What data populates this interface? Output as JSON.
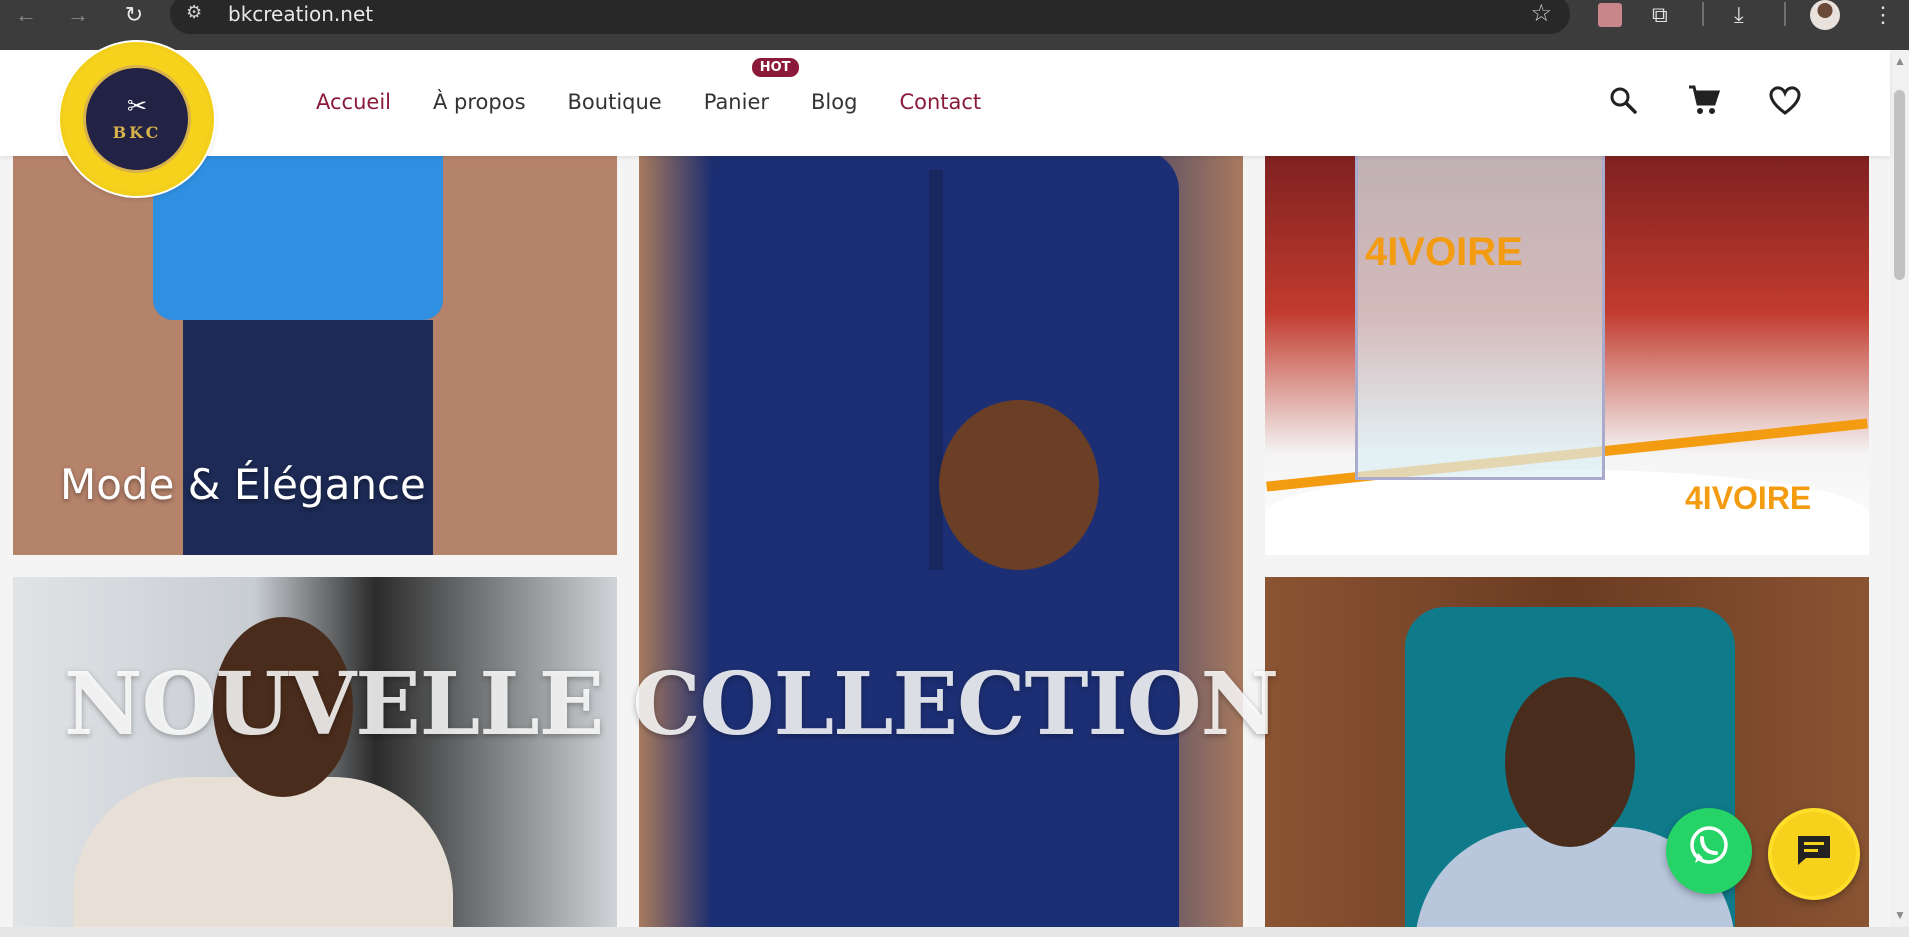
{
  "browser": {
    "url": "bkcreation.net",
    "back_icon": "arrow-left",
    "forward_icon": "arrow-right",
    "reload_icon": "reload",
    "site_info_icon": "site-settings",
    "bookmark_icon": "star"
  },
  "header": {
    "logo_text": "BKC",
    "nav": {
      "home": "Accueil",
      "about": "À propos",
      "shop": "Boutique",
      "cart": "Panier",
      "cart_badge": "HOT",
      "blog": "Blog",
      "contact": "Contact"
    },
    "accent_color": "#8b1a3a"
  },
  "hero": {
    "title": "Mode & Élégance",
    "overlay_text": "NOUVELLE COLLECTION",
    "brand_tile_logo": "4IVOIRE",
    "brand_tile_logo_small": "4IVOIRE"
  },
  "floating": {
    "whatsapp_icon": "whatsapp",
    "chat_icon": "chat-bubble",
    "whatsapp_color": "#25d366",
    "chat_color": "#f6d21c"
  }
}
